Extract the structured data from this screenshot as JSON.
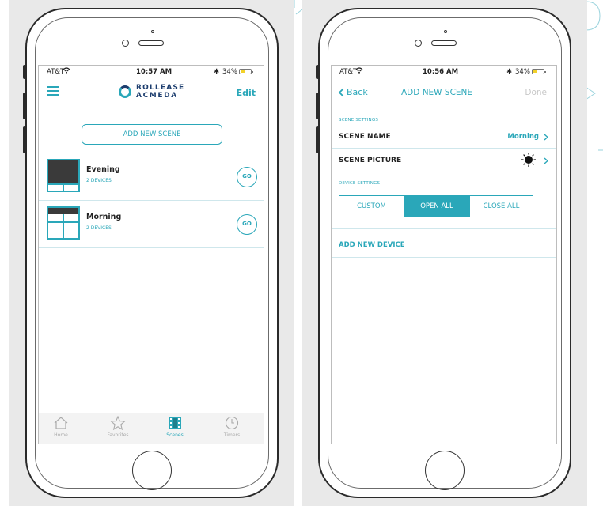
{
  "colors": {
    "accent": "#2aa7b9",
    "panel_bg": "#e9e9e9",
    "text": "#222222"
  },
  "left_screen": {
    "status": {
      "carrier": "AT&T",
      "time": "10:57 AM",
      "battery": "34%"
    },
    "header": {
      "menu_icon": "hamburger-menu-icon",
      "logo_line1": "ROLLEASE",
      "logo_line2": "ACMEDA",
      "edit_label": "Edit"
    },
    "add_button": "ADD NEW SCENE",
    "scenes": [
      {
        "name": "Evening",
        "devices": "2 DEVICES",
        "go_label": "GO",
        "thumb": "closed-blind"
      },
      {
        "name": "Morning",
        "devices": "2 DEVICES",
        "go_label": "GO",
        "thumb": "open-window"
      }
    ],
    "tabs": [
      {
        "label": "Home",
        "icon": "home-icon",
        "active": false
      },
      {
        "label": "Favorites",
        "icon": "star-icon",
        "active": false
      },
      {
        "label": "Scenes",
        "icon": "film-icon",
        "active": true
      },
      {
        "label": "Timers",
        "icon": "clock-icon",
        "active": false
      }
    ]
  },
  "right_screen": {
    "status": {
      "carrier": "AT&T",
      "time": "10:56 AM",
      "battery": "34%"
    },
    "nav": {
      "back_label": "Back",
      "title": "ADD NEW SCENE",
      "done_label": "Done"
    },
    "scene_settings_label": "SCENE SETTINGS",
    "scene_name": {
      "label": "SCENE NAME",
      "value": "Morning"
    },
    "scene_picture": {
      "label": "SCENE PICTURE",
      "icon": "sun-icon"
    },
    "device_settings_label": "DEVICE SETTINGS",
    "segments": [
      {
        "label": "CUSTOM",
        "selected": false
      },
      {
        "label": "OPEN ALL",
        "selected": true
      },
      {
        "label": "CLOSE ALL",
        "selected": false
      }
    ],
    "add_device_label": "ADD NEW DEVICE"
  }
}
